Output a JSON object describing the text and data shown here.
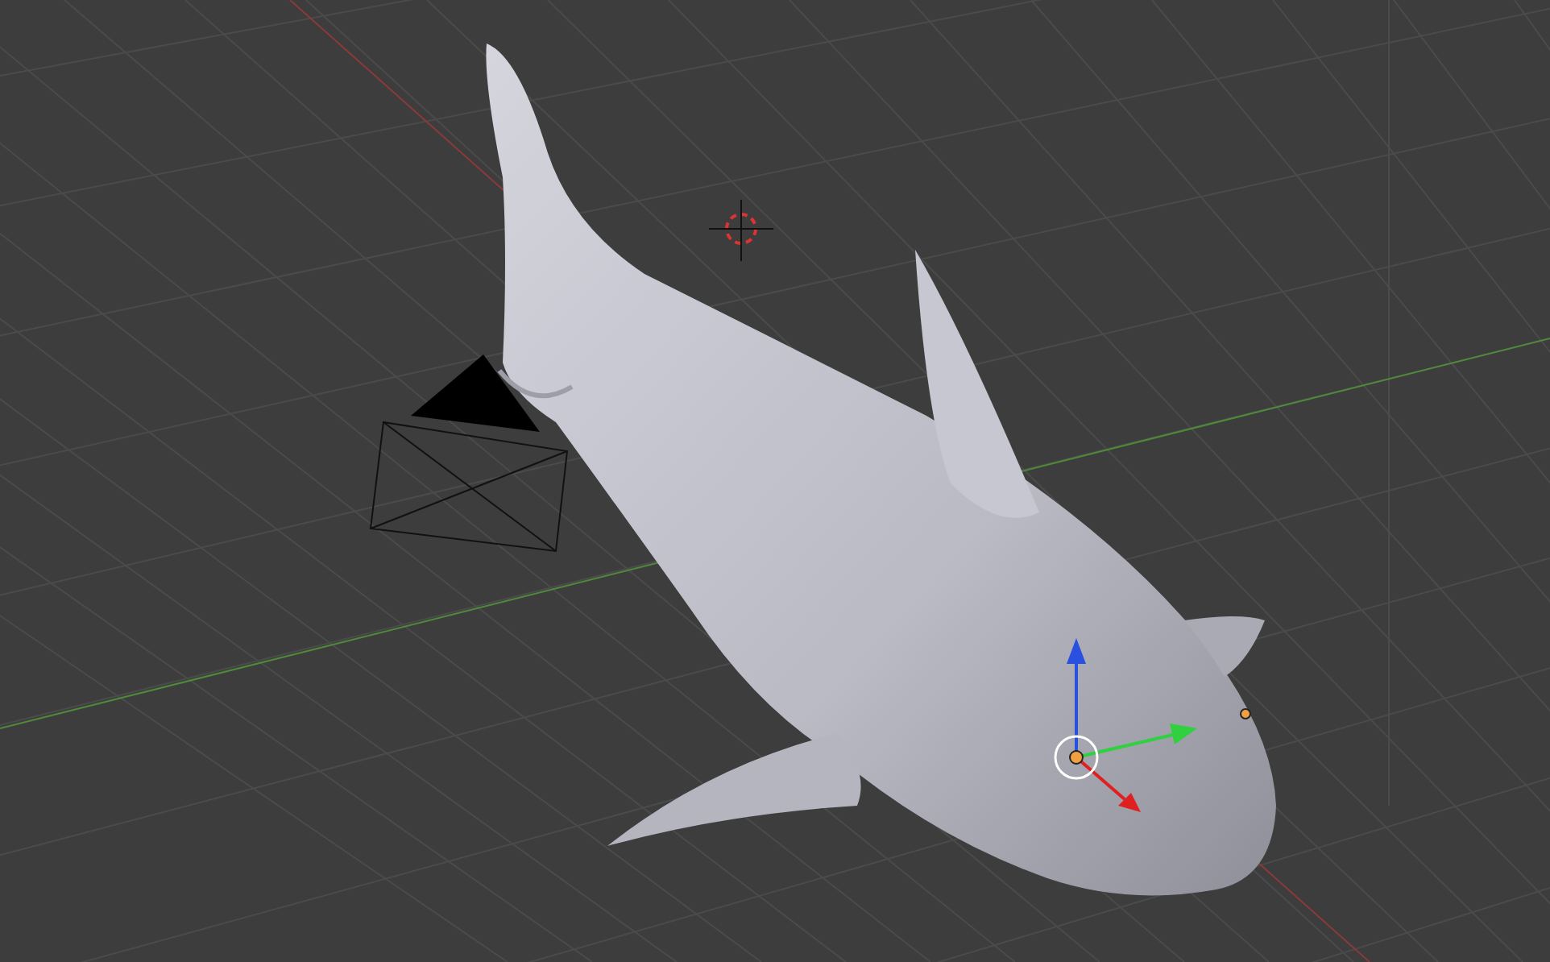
{
  "viewport": {
    "show_grid": true,
    "show_gizmo": true
  }
}
